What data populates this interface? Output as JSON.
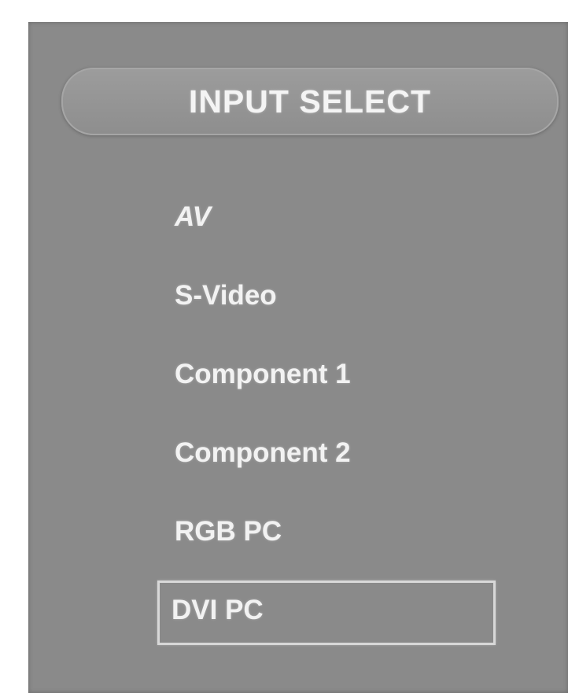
{
  "osd": {
    "title": "INPUT SELECT",
    "items": [
      {
        "label": "AV"
      },
      {
        "label": "S-Video"
      },
      {
        "label": "Component 1"
      },
      {
        "label": "Component 2"
      },
      {
        "label": "RGB PC"
      },
      {
        "label": "DVI PC"
      }
    ],
    "selected_index": 5
  },
  "colors": {
    "panel_background": "#8a8a8a",
    "text": "#f2f2f2",
    "selection_border": "#d8d8d8"
  }
}
